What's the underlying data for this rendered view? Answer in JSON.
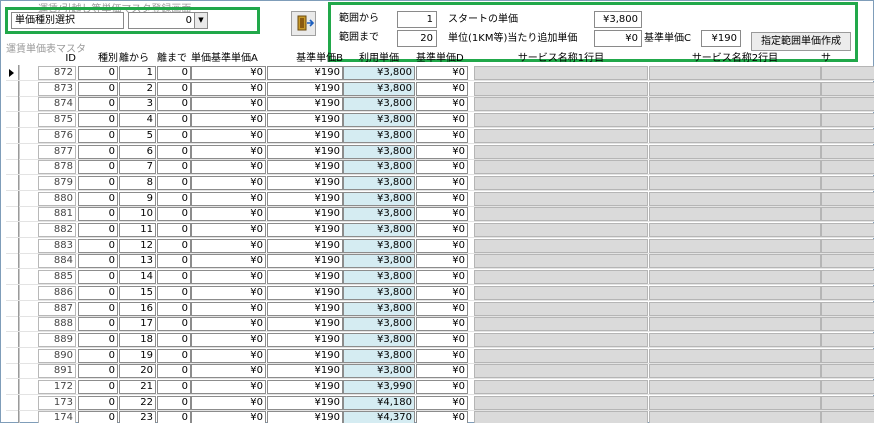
{
  "form_title": "運賃/引越し等単価マスタ登録画面",
  "subform_title": "運賃単価表マスタ",
  "selector": {
    "label": "単価種別選択",
    "value": "0"
  },
  "range_panel": {
    "from_label": "範囲から",
    "from_value": "1",
    "to_label": "範囲まで",
    "to_value": "20",
    "start_price_label": "スタートの単価",
    "start_price_value": "¥3,800",
    "add_price_label": "単位(1KM等)当たり追加単価",
    "add_price_value": "¥0",
    "base_c_label": "基準単価C",
    "base_c_value": "¥190",
    "create_button": "指定範囲単価作成"
  },
  "icons": {
    "exit": "exit-door-icon",
    "record_selector": "current-record-arrow-icon"
  },
  "colors": {
    "highlight_border": "#21a84a",
    "price_column": "#d5ecf2",
    "service_column": "#dadada"
  },
  "columns": [
    "ID",
    "種別",
    "離から",
    "離まで",
    "単価基準単価A",
    "基準単価B",
    "利用単価",
    "基準単価D",
    "サービス名称1行目",
    "サービス名称2行目",
    "サ"
  ],
  "rows": [
    [
      "872",
      "0",
      "1",
      "0",
      "¥0",
      "¥190",
      "¥3,800",
      "¥0"
    ],
    [
      "873",
      "0",
      "2",
      "0",
      "¥0",
      "¥190",
      "¥3,800",
      "¥0"
    ],
    [
      "874",
      "0",
      "3",
      "0",
      "¥0",
      "¥190",
      "¥3,800",
      "¥0"
    ],
    [
      "875",
      "0",
      "4",
      "0",
      "¥0",
      "¥190",
      "¥3,800",
      "¥0"
    ],
    [
      "876",
      "0",
      "5",
      "0",
      "¥0",
      "¥190",
      "¥3,800",
      "¥0"
    ],
    [
      "877",
      "0",
      "6",
      "0",
      "¥0",
      "¥190",
      "¥3,800",
      "¥0"
    ],
    [
      "878",
      "0",
      "7",
      "0",
      "¥0",
      "¥190",
      "¥3,800",
      "¥0"
    ],
    [
      "879",
      "0",
      "8",
      "0",
      "¥0",
      "¥190",
      "¥3,800",
      "¥0"
    ],
    [
      "880",
      "0",
      "9",
      "0",
      "¥0",
      "¥190",
      "¥3,800",
      "¥0"
    ],
    [
      "881",
      "0",
      "10",
      "0",
      "¥0",
      "¥190",
      "¥3,800",
      "¥0"
    ],
    [
      "882",
      "0",
      "11",
      "0",
      "¥0",
      "¥190",
      "¥3,800",
      "¥0"
    ],
    [
      "883",
      "0",
      "12",
      "0",
      "¥0",
      "¥190",
      "¥3,800",
      "¥0"
    ],
    [
      "884",
      "0",
      "13",
      "0",
      "¥0",
      "¥190",
      "¥3,800",
      "¥0"
    ],
    [
      "885",
      "0",
      "14",
      "0",
      "¥0",
      "¥190",
      "¥3,800",
      "¥0"
    ],
    [
      "886",
      "0",
      "15",
      "0",
      "¥0",
      "¥190",
      "¥3,800",
      "¥0"
    ],
    [
      "887",
      "0",
      "16",
      "0",
      "¥0",
      "¥190",
      "¥3,800",
      "¥0"
    ],
    [
      "888",
      "0",
      "17",
      "0",
      "¥0",
      "¥190",
      "¥3,800",
      "¥0"
    ],
    [
      "889",
      "0",
      "18",
      "0",
      "¥0",
      "¥190",
      "¥3,800",
      "¥0"
    ],
    [
      "890",
      "0",
      "19",
      "0",
      "¥0",
      "¥190",
      "¥3,800",
      "¥0"
    ],
    [
      "891",
      "0",
      "20",
      "0",
      "¥0",
      "¥190",
      "¥3,800",
      "¥0"
    ],
    [
      "172",
      "0",
      "21",
      "0",
      "¥0",
      "¥190",
      "¥3,990",
      "¥0"
    ],
    [
      "173",
      "0",
      "22",
      "0",
      "¥0",
      "¥190",
      "¥4,180",
      "¥0"
    ],
    [
      "174",
      "0",
      "23",
      "0",
      "¥0",
      "¥190",
      "¥4,370",
      "¥0"
    ]
  ]
}
